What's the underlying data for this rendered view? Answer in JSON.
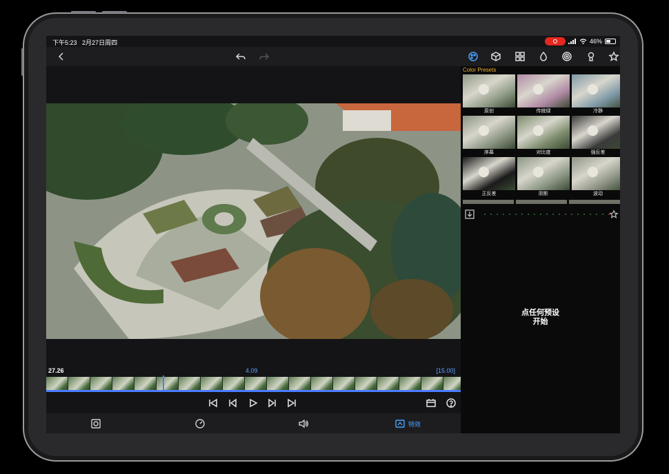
{
  "status_bar": {
    "time": "下午5:23",
    "date": "2月27日周四",
    "battery": "46%"
  },
  "timeline": {
    "current": "27.26",
    "marker": "4.09",
    "duration": "[15.00]"
  },
  "bottom_bar": {
    "effects_label": "特效"
  },
  "panel": {
    "section_title": "Color Presets",
    "presets": [
      {
        "name": "原创",
        "tint": "#8f9a86"
      },
      {
        "name": "传统绿",
        "tint": "#b08aa4"
      },
      {
        "name": "冷静",
        "tint": "#7e98a6"
      },
      {
        "name": "序幕",
        "tint": "#8a9482"
      },
      {
        "name": "对比度",
        "tint": "#7a8a6a"
      },
      {
        "name": "强反差",
        "tint": "#3a3a3a"
      },
      {
        "name": "正反差",
        "tint": "#1a1a1a"
      },
      {
        "name": "阴影",
        "tint": "#8b9684"
      },
      {
        "name": "波动",
        "tint": "#8e9486"
      }
    ],
    "hint_line1": "点任何预设",
    "hint_line2": "开始"
  },
  "colors": {
    "accent_blue": "#4a7dff",
    "preset_title": "#f2b22e",
    "record_red": "#e5281f"
  },
  "icons": [
    "back-icon",
    "undo-icon",
    "redo-icon",
    "palette-icon",
    "cube-icon",
    "grid-icon",
    "drop-icon",
    "spiral-icon",
    "keyhole-icon",
    "star-icon",
    "download-icon",
    "star-add-icon",
    "skip-start-icon",
    "step-back-icon",
    "play-icon",
    "step-forward-icon",
    "skip-end-icon",
    "storyboard-icon",
    "help-icon",
    "crop-icon",
    "speed-icon",
    "volume-icon",
    "effects-icon"
  ]
}
